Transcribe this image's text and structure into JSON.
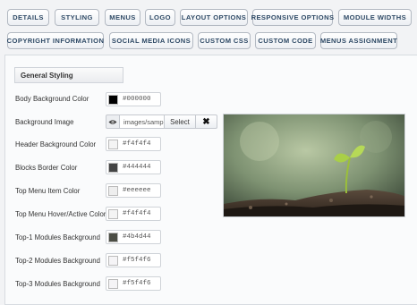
{
  "tabs": [
    {
      "label": "DETAILS"
    },
    {
      "label": "STYLING"
    },
    {
      "label": "MENUS"
    },
    {
      "label": "LOGO"
    },
    {
      "label": "LAYOUT OPTIONS"
    },
    {
      "label": "RESPONSIVE OPTIONS"
    },
    {
      "label": "MODULE WIDTHS"
    },
    {
      "label": "COPYRIGHT INFORMATION"
    },
    {
      "label": "SOCIAL MEDIA ICONS"
    },
    {
      "label": "CUSTOM CSS"
    },
    {
      "label": "CUSTOM CODE"
    },
    {
      "label": "MENUS ASSIGNMENT"
    }
  ],
  "section": {
    "title": "General Styling"
  },
  "fields": {
    "body_bg": {
      "label": "Body Background Color",
      "value": "#000000",
      "swatch": "#000000"
    },
    "bg_image": {
      "label": "Background Image",
      "value": "images/sample",
      "select_label": "Select",
      "clear_label": "✖",
      "preview_icon": "eye-icon"
    },
    "header_bg": {
      "label": "Header Background Color",
      "value": "#f4f4f4",
      "swatch": "#f4f4f4"
    },
    "blocks_border": {
      "label": "Blocks Border Color",
      "value": "#444444",
      "swatch": "#444444"
    },
    "top_menu_item": {
      "label": "Top Menu Item Color",
      "value": "#eeeeee",
      "swatch": "#eeeeee"
    },
    "top_menu_hover": {
      "label": "Top Menu Hover/Active Color",
      "value": "#f4f4f4",
      "swatch": "#f4f4f4"
    },
    "top1_modules": {
      "label": "Top-1 Modules Background",
      "value": "#4b4d44",
      "swatch": "#4b4d44"
    },
    "top2_modules": {
      "label": "Top-2 Modules Background",
      "value": "#f5f4f6",
      "swatch": "#f5f4f6"
    },
    "top3_modules": {
      "label": "Top-3 Modules Background",
      "value": "#f5f4f6",
      "swatch": "#f5f4f6"
    }
  }
}
